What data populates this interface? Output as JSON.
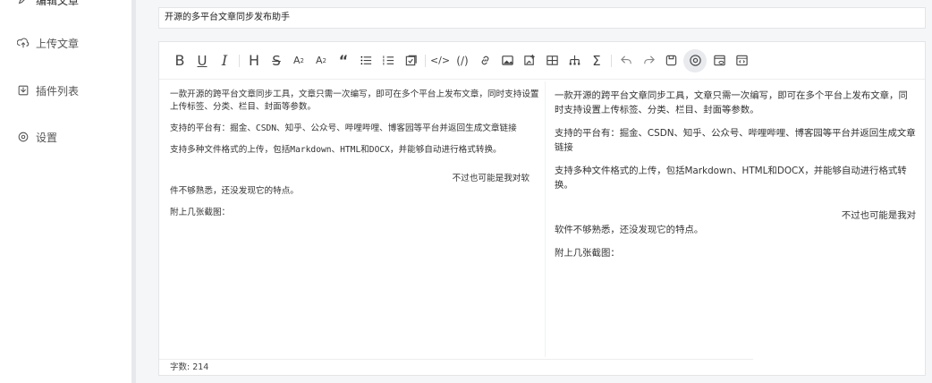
{
  "sidebar": {
    "items": [
      {
        "label": "编辑文章",
        "icon": "edit-icon"
      },
      {
        "label": "上传文章",
        "icon": "upload-icon"
      },
      {
        "label": "插件列表",
        "icon": "plugin-list-icon"
      },
      {
        "label": "设置",
        "icon": "settings-icon"
      }
    ]
  },
  "editor": {
    "title_value": "开源的多平台文章同步发布助手",
    "toolbar": [
      "bold-icon",
      "underline-icon",
      "italic-icon",
      "heading-icon",
      "strikethrough-icon",
      "subscript-icon",
      "superscript-icon",
      "quote-icon",
      "unordered-list-icon",
      "ordered-list-icon",
      "task-list-icon",
      "code-icon",
      "inline-formula-icon",
      "link-icon",
      "image-icon",
      "image-edit-icon",
      "table-icon",
      "chart-icon",
      "formula-icon",
      "undo-icon",
      "redo-icon",
      "save-icon",
      "preview-icon",
      "preview-only-icon",
      "code-preview-icon"
    ],
    "source": {
      "p1": "一款开源的跨平台文章同步工具，文章只需一次编写，即可在多个平台上发布文章，同时支持设置上传标签、分类、栏目、封面等参数。",
      "p2": "支持的平台有：掘金、CSDN、知乎、公众号、哔哩哔哩、博客园等平台并返回生成文章链接",
      "p3": "支持多种文件格式的上传，包括Markdown、HTML和DOCX，并能够自动进行格式转换。",
      "p4a": "不过也可能是我对软",
      "p4b": "件不够熟悉，还没发现它的特点。",
      "p5": "附上几张截图："
    },
    "preview": {
      "p1": "一款开源的跨平台文章同步工具，文章只需一次编写，即可在多个平台上发布文章，同时支持设置上传标签、分类、栏目、封面等参数。",
      "p2": "支持的平台有：掘金、CSDN、知乎、公众号、哔哩哔哩、博客园等平台并返回生成文章链接",
      "p3": "支持多种文件格式的上传，包括Markdown、HTML和DOCX，并能够自动进行格式转换。",
      "p4a": "不过也可能是我对",
      "p4b": "软件不够熟悉，还没发现它的特点。",
      "p5": "附上几张截图："
    },
    "word_count": "字数: 214"
  },
  "colors": {
    "sidebar_bg": "#ffffff",
    "main_bg": "#f5f6f7",
    "active_button_bg": "#e8eaee"
  }
}
